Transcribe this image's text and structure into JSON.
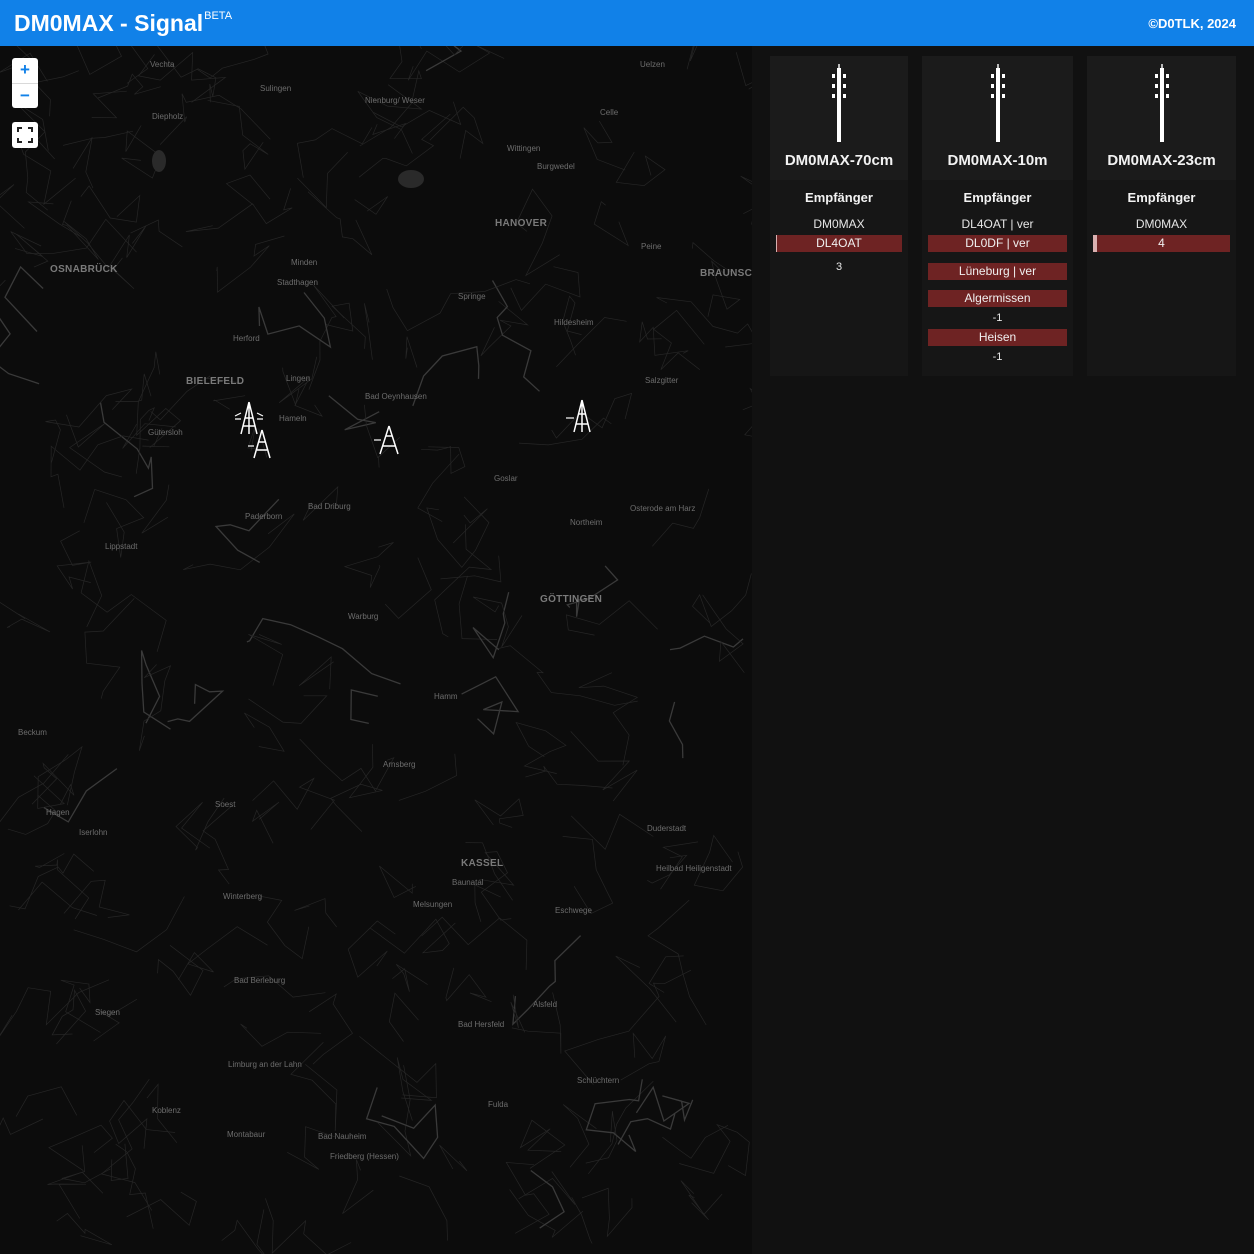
{
  "header": {
    "title": "DM0MAX - Signal",
    "beta": "BETA",
    "copyright": "©D0TLK, 2024"
  },
  "map": {
    "zoom_in": "+",
    "zoom_out": "−",
    "fullscreen": "fullscreen-icon",
    "cities": [
      {
        "name": "Vechta",
        "big": false
      },
      {
        "name": "Diepholz",
        "big": false
      },
      {
        "name": "Sulingen",
        "big": false
      },
      {
        "name": "Nienburg/ Weser",
        "big": false
      },
      {
        "name": "Uelzen",
        "big": false
      },
      {
        "name": "Celle",
        "big": false
      },
      {
        "name": "Wittingen",
        "big": false
      },
      {
        "name": "Burgwedel",
        "big": false
      },
      {
        "name": "OSNABRÜCK",
        "big": true
      },
      {
        "name": "HANOVER",
        "big": true
      },
      {
        "name": "BRAUNSCHW",
        "big": true
      },
      {
        "name": "Peine",
        "big": false
      },
      {
        "name": "Minden",
        "big": false
      },
      {
        "name": "Stadthagen",
        "big": false
      },
      {
        "name": "Springe",
        "big": false
      },
      {
        "name": "Hildesheim",
        "big": false
      },
      {
        "name": "Salzgitter",
        "big": false
      },
      {
        "name": "Herford",
        "big": false
      },
      {
        "name": "BIELEFELD",
        "big": true
      },
      {
        "name": "Lingen",
        "big": false
      },
      {
        "name": "Hameln",
        "big": false
      },
      {
        "name": "Gütersloh",
        "big": false
      },
      {
        "name": "Bad Oeynhausen",
        "big": false
      },
      {
        "name": "Goslar",
        "big": false
      },
      {
        "name": "Osterode am Harz",
        "big": false
      },
      {
        "name": "Paderborn",
        "big": false
      },
      {
        "name": "Bad Driburg",
        "big": false
      },
      {
        "name": "Northeim",
        "big": false
      },
      {
        "name": "Lippstadt",
        "big": false
      },
      {
        "name": "GÖTTINGEN",
        "big": true
      },
      {
        "name": "Warburg",
        "big": false
      },
      {
        "name": "Hamm",
        "big": false
      },
      {
        "name": "Beckum",
        "big": false
      },
      {
        "name": "Arnsberg",
        "big": false
      },
      {
        "name": "Soest",
        "big": false
      },
      {
        "name": "Hagen",
        "big": false
      },
      {
        "name": "Iserlohn",
        "big": false
      },
      {
        "name": "KASSEL",
        "big": true
      },
      {
        "name": "Baunatal",
        "big": false
      },
      {
        "name": "Melsungen",
        "big": false
      },
      {
        "name": "Eschwege",
        "big": false
      },
      {
        "name": "Duderstadt",
        "big": false
      },
      {
        "name": "Heilbad Heiligenstadt",
        "big": false
      },
      {
        "name": "Winterberg",
        "big": false
      },
      {
        "name": "Bad Berleburg",
        "big": false
      },
      {
        "name": "Siegen",
        "big": false
      },
      {
        "name": "Alsfeld",
        "big": false
      },
      {
        "name": "Bad Hersfeld",
        "big": false
      },
      {
        "name": "Fulda",
        "big": false
      },
      {
        "name": "Schlüchtern",
        "big": false
      },
      {
        "name": "Limburg an der Lahn",
        "big": false
      },
      {
        "name": "Koblenz",
        "big": false
      },
      {
        "name": "Montabaur",
        "big": false
      },
      {
        "name": "Bad Nauheim",
        "big": false
      },
      {
        "name": "Friedberg (Hessen)",
        "big": false
      }
    ]
  },
  "cards": [
    {
      "title": "DM0MAX-70cm",
      "subtitle": "Empfänger",
      "station": "DM0MAX",
      "bars": [
        {
          "label": "DL4OAT",
          "level": 0.01
        }
      ],
      "value": "3"
    },
    {
      "title": "DM0MAX-10m",
      "subtitle": "Empfänger",
      "station": "DL4OAT  |  ver",
      "bars": [
        {
          "label": "DL0DF  |  ver",
          "level": 0
        },
        {
          "label": "Lüneburg  |  ver",
          "level": 0
        },
        {
          "label": "Algermissen",
          "level": 0,
          "value": "-1"
        },
        {
          "label": "Heisen",
          "level": 0,
          "value": "-1"
        }
      ]
    },
    {
      "title": "DM0MAX-23cm",
      "subtitle": "Empfänger",
      "station": "DM0MAX",
      "bars": [
        {
          "label": "4",
          "level": 0.03
        }
      ]
    }
  ],
  "colors": {
    "header": "#1181e8",
    "bar": "#6e2323",
    "bar_fill": "#d9b0b0"
  }
}
